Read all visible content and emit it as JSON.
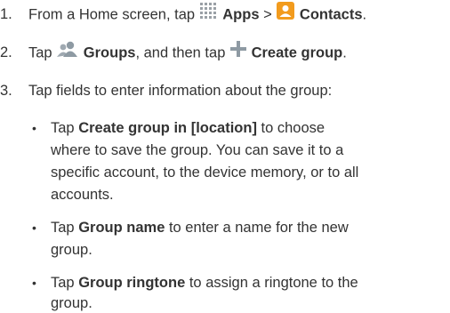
{
  "steps": [
    {
      "number": "1.",
      "parts": {
        "a": "From a Home screen, tap ",
        "apps": "Apps",
        "sep": " > ",
        "contacts": "Contacts",
        "end": "."
      }
    },
    {
      "number": "2.",
      "parts": {
        "a": "Tap ",
        "groups": "Groups",
        "b": ", and then tap ",
        "create": "Create group",
        "end": "."
      }
    },
    {
      "number": "3.",
      "parts": {
        "a": "Tap fields to enter information about the group:"
      }
    }
  ],
  "bullets": [
    {
      "symbol": "•",
      "lines": {
        "l1_pre": "Tap ",
        "l1_bold": "Create group in [location]",
        "l1_post": " to choose",
        "l2": "where to save the group. You can save it to a",
        "l3": "specific account, to the device memory, or to all",
        "l4": "accounts."
      }
    },
    {
      "symbol": "•",
      "lines": {
        "l1_pre": "Tap ",
        "l1_bold": "Group name",
        "l1_post": " to enter a name for the new",
        "l2": "group."
      }
    },
    {
      "symbol": "•",
      "lines": {
        "l1_pre": "Tap ",
        "l1_bold": "Group ringtone",
        "l1_post": " to assign a ringtone to the",
        "l2": "group."
      }
    }
  ],
  "icons": {
    "apps_color": "#9aa0a6",
    "contacts_color": "#f29b1d",
    "groups_color": "#8e9aa3",
    "plus_color": "#8e9aa3"
  }
}
